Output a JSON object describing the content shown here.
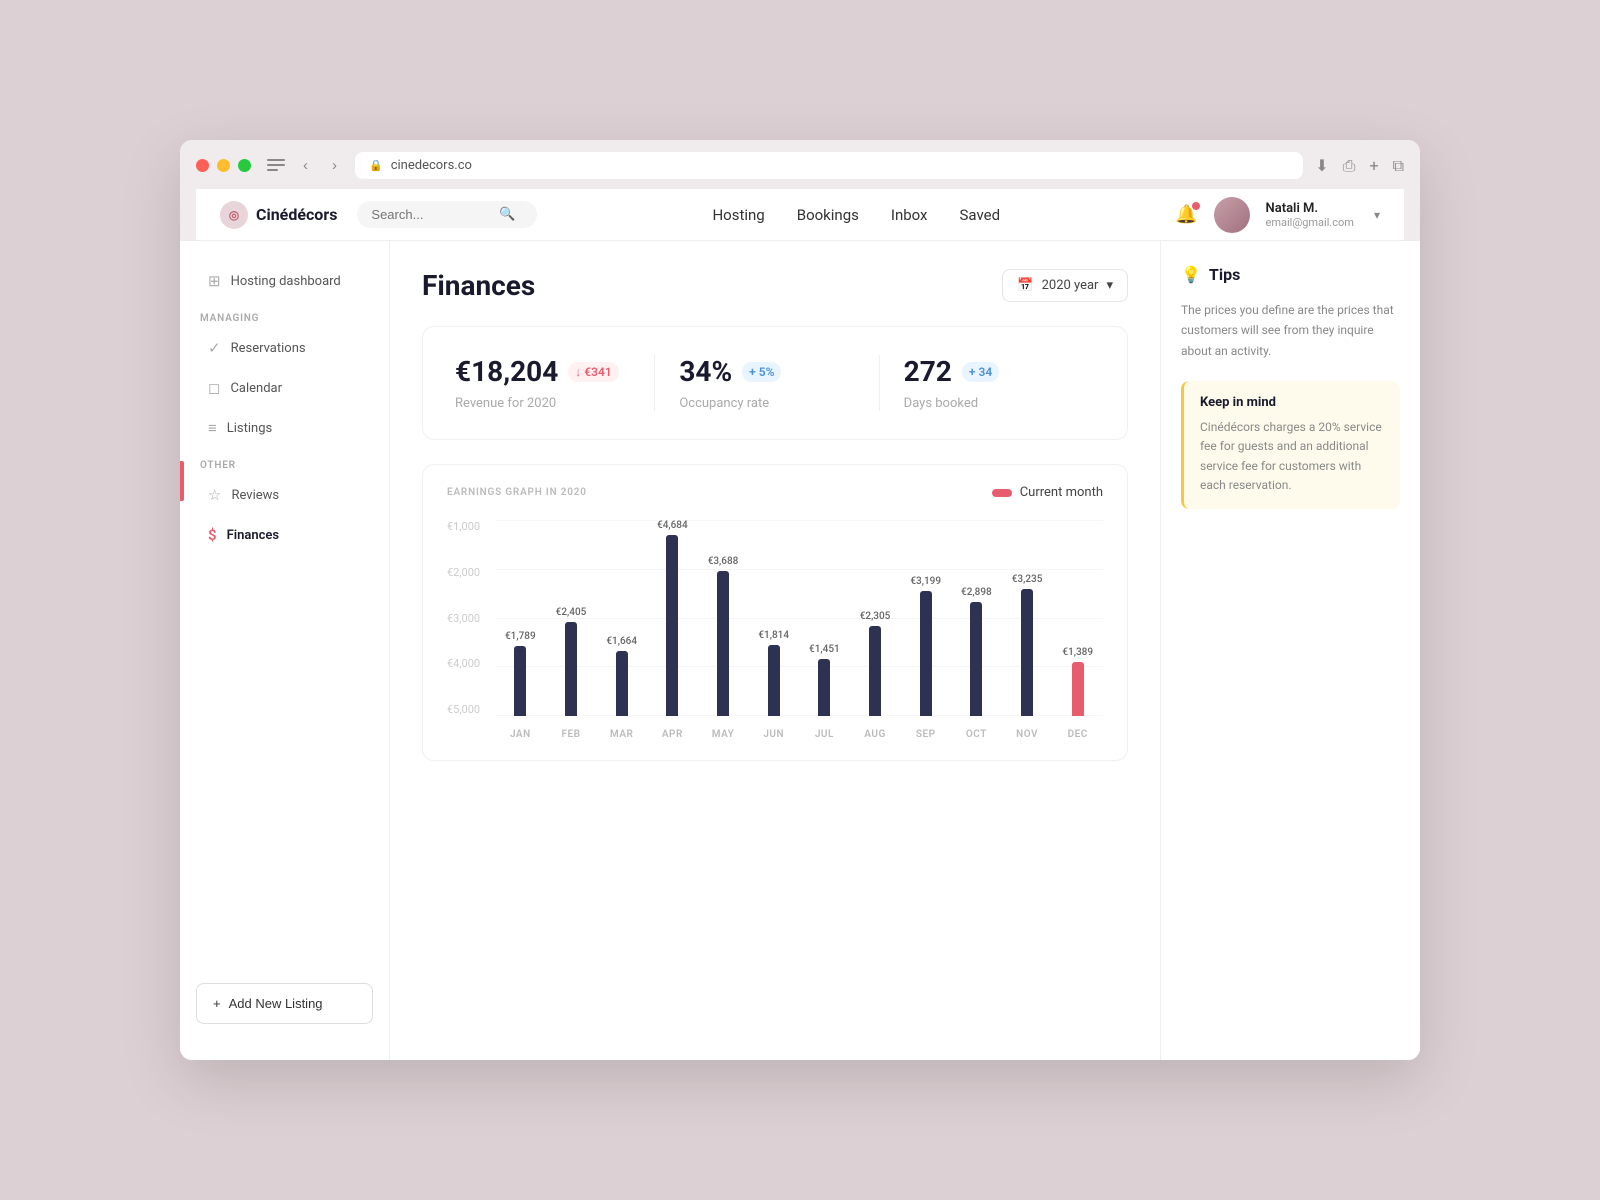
{
  "browser": {
    "url": "cinedecors.co",
    "back_btn": "‹",
    "forward_btn": "›"
  },
  "nav": {
    "brand": "Cinédécors",
    "search_placeholder": "Search...",
    "links": [
      "Hosting",
      "Bookings",
      "Inbox",
      "Saved"
    ],
    "user_name": "Natali M.",
    "user_email": "email@gmail.com"
  },
  "sidebar": {
    "top_item": "Hosting dashboard",
    "managing_label": "MANAGING",
    "managing_items": [
      {
        "id": "reservations",
        "label": "Reservations",
        "icon": "✓"
      },
      {
        "id": "calendar",
        "label": "Calendar",
        "icon": "◻"
      },
      {
        "id": "listings",
        "label": "Listings",
        "icon": "≡"
      }
    ],
    "other_label": "OTHER",
    "other_items": [
      {
        "id": "reviews",
        "label": "Reviews",
        "icon": "☆"
      },
      {
        "id": "finances",
        "label": "Finances",
        "icon": "$",
        "active": true
      }
    ],
    "add_listing_label": "Add New Listing"
  },
  "main": {
    "page_title": "Finances",
    "year_selector": "2020 year",
    "stats": [
      {
        "value": "€18,204",
        "badge": "€341",
        "badge_type": "positive",
        "badge_icon": "↓",
        "label": "Revenue for 2020"
      },
      {
        "value": "34%",
        "badge": "5%",
        "badge_type": "blue",
        "badge_icon": "+",
        "label": "Occupancy rate"
      },
      {
        "value": "272",
        "badge": "34",
        "badge_type": "blue",
        "badge_icon": "+",
        "label": "Days booked"
      }
    ],
    "chart": {
      "title": "EARNINGS GRAPH IN 2020",
      "current_month_label": "Current month",
      "y_labels": [
        "€5,000",
        "€4,000",
        "€3,000",
        "€2,000",
        "€1,000"
      ],
      "bars": [
        {
          "month": "JAN",
          "value": "€1,789",
          "amount": 1789,
          "current": false
        },
        {
          "month": "FEB",
          "value": "€2,405",
          "amount": 2405,
          "current": false
        },
        {
          "month": "MAR",
          "value": "€1,664",
          "amount": 1664,
          "current": false
        },
        {
          "month": "APR",
          "value": "€4,684",
          "amount": 4684,
          "current": false
        },
        {
          "month": "MAY",
          "value": "€3,688",
          "amount": 3688,
          "current": false
        },
        {
          "month": "JUN",
          "value": "€1,814",
          "amount": 1814,
          "current": false
        },
        {
          "month": "JUL",
          "value": "€1,451",
          "amount": 1451,
          "current": false
        },
        {
          "month": "AUG",
          "value": "€2,305",
          "amount": 2305,
          "current": false
        },
        {
          "month": "SEP",
          "value": "€3,199",
          "amount": 3199,
          "current": false
        },
        {
          "month": "OCT",
          "value": "€2,898",
          "amount": 2898,
          "current": false
        },
        {
          "month": "NOV",
          "value": "€3,235",
          "amount": 3235,
          "current": false
        },
        {
          "month": "DEC",
          "value": "€1,389",
          "amount": 1389,
          "current": true
        }
      ],
      "max_value": 5000
    }
  },
  "tips": {
    "title": "Tips",
    "description": "The prices you define are the prices that customers will see from they inquire about an activity.",
    "keep_in_mind_title": "Keep in mind",
    "keep_in_mind_text": "Cinédécors charges a 20% service fee for guests and an additional service fee for customers with each reservation."
  }
}
